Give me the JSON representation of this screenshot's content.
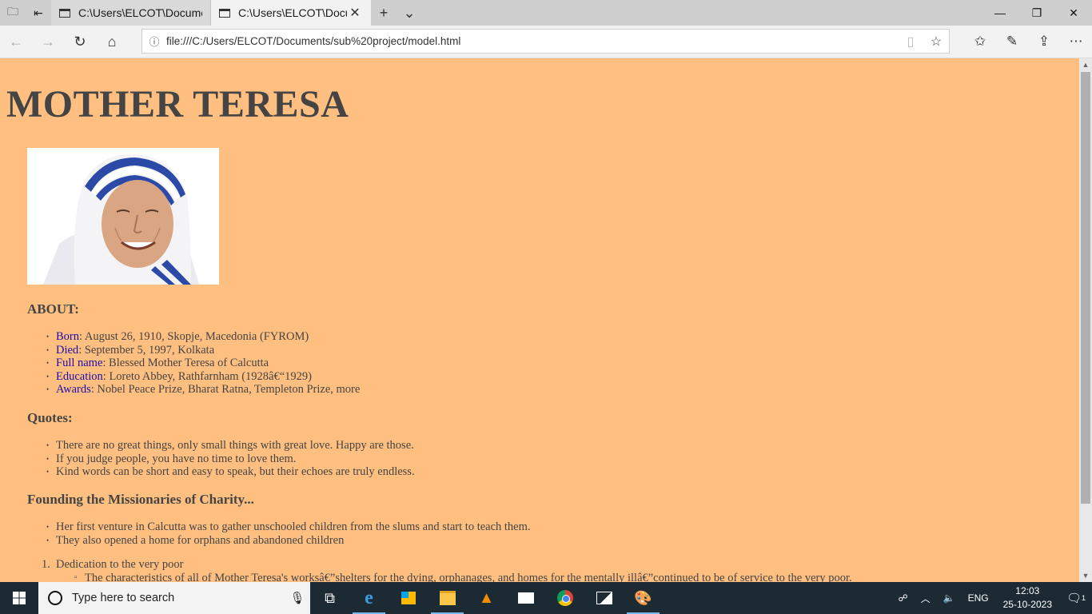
{
  "browser": {
    "tabs": [
      {
        "title": "C:\\Users\\ELCOT\\Documents",
        "active": false
      },
      {
        "title": "C:\\Users\\ELCOT\\Docum",
        "active": true
      }
    ],
    "url": "file:///C:/Users/ELCOT/Documents/sub%20project/model.html"
  },
  "page": {
    "title": "MOTHER TERESA",
    "about_heading": "ABOUT:",
    "about": [
      {
        "label": "Born",
        "value": ": August 26, 1910, Skopje, Macedonia (FYROM)"
      },
      {
        "label": "Died",
        "value": ": September 5, 1997, Kolkata"
      },
      {
        "label": "Full name",
        "value": ": Blessed Mother Teresa of Calcutta"
      },
      {
        "label": "Education",
        "value": ": Loreto Abbey, Rathfarnham (1928â€“1929)"
      },
      {
        "label": "Awards",
        "value": ": Nobel Peace Prize, Bharat Ratna, Templeton Prize, more"
      }
    ],
    "quotes_heading": "Quotes:",
    "quotes": [
      "There are no great things, only small things with great love. Happy are those.",
      "If you judge people, you have no time to love them.",
      "Kind words can be short and easy to speak, but their echoes are truly endless."
    ],
    "founding_heading": "Founding the Missionaries of Charity...",
    "founding": [
      "Her first venture in Calcutta was to gather unschooled children from the slums and start to teach them.",
      "They also opened a home for orphans and abandoned children"
    ],
    "numbered": [
      {
        "num": "1",
        "text": "Dedication to the very poor",
        "sub": [
          "The characteristics of all of Mother Teresa's worksâ€”shelters for the dying, orphanages, and homes for the mentally illâ€”continued to be of service to the very poor."
        ]
      }
    ]
  },
  "taskbar": {
    "search_placeholder": "Type here to search",
    "language": "ENG",
    "time": "12:03",
    "date": "25-10-2023",
    "notification_count": "1"
  }
}
